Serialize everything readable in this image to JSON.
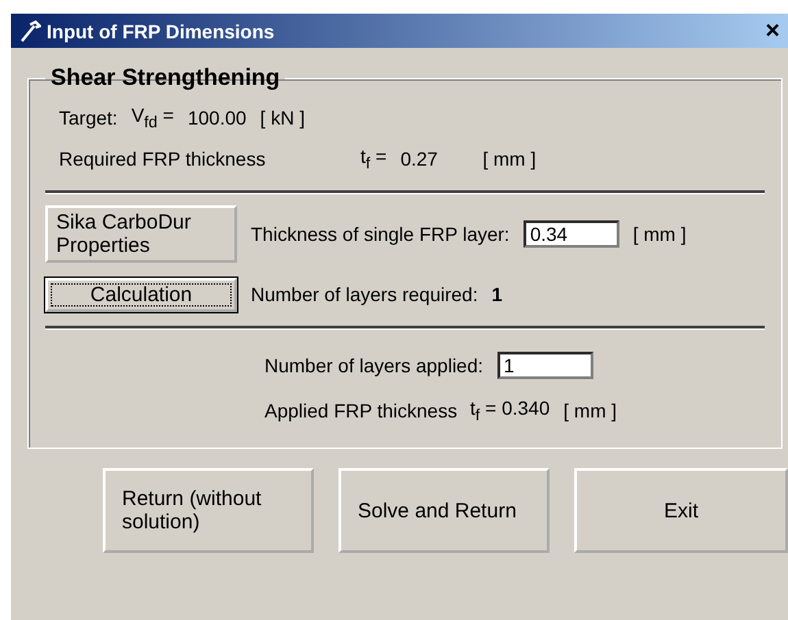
{
  "window": {
    "title": "Input of FRP Dimensions",
    "close": "×"
  },
  "group": {
    "title": "Shear Strengthening",
    "target": {
      "label": "Target:",
      "symbol": "V$_{fd}$ =",
      "value": "100.00",
      "unit": "[ kN ]"
    },
    "required": {
      "label": "Required FRP thickness",
      "symbol": "t$_{f}$ =",
      "value": "0.27",
      "unit": "[ mm ]"
    },
    "properties_button": "Sika CarboDur Properties",
    "calculation_button": {
      "label": "Calculation",
      "focused": true
    },
    "single_layer": {
      "label": "Thickness of single FRP layer:",
      "value": "0.34",
      "unit": "[ mm ]"
    },
    "layers_required": {
      "label": "Number of layers required:",
      "value": "1"
    },
    "layers_applied": {
      "label": "Number of layers applied:",
      "value": "1"
    },
    "applied": {
      "label": "Applied FRP thickness",
      "symbol": "t$_{f}$ = 0.340",
      "unit": "[ mm ]"
    }
  },
  "buttons": [
    "Return (without solution)",
    "Solve and Return",
    "Exit"
  ]
}
